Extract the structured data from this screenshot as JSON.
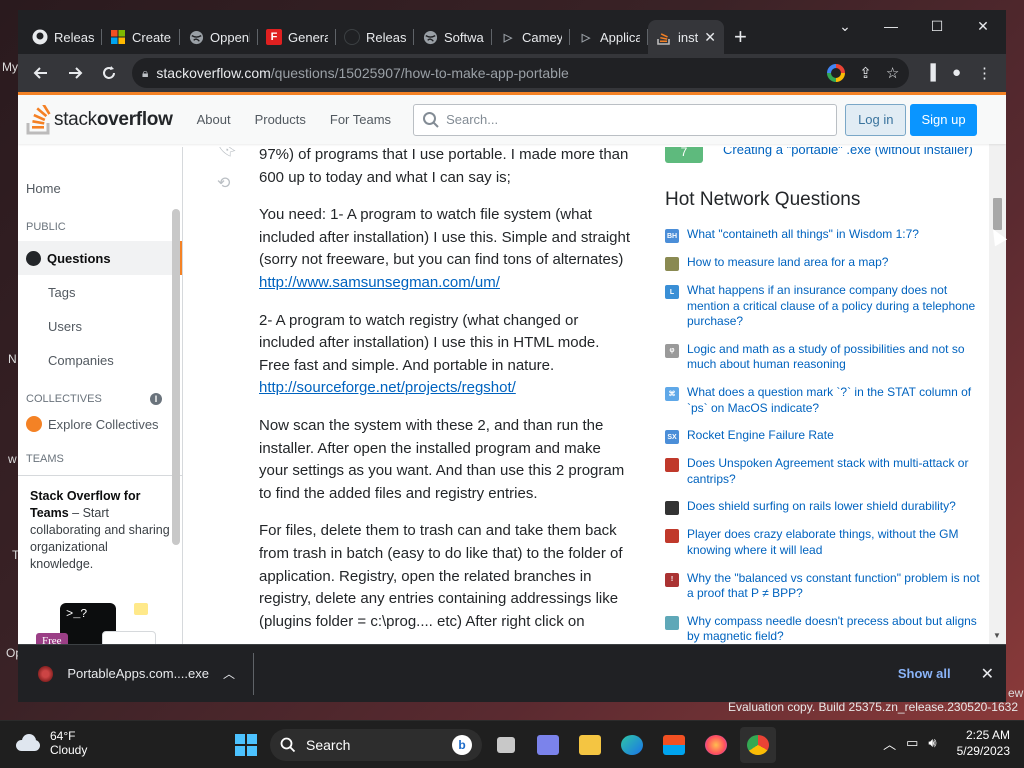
{
  "desktop": {
    "left_fragments": [
      "My",
      "N",
      "w",
      "T",
      "Op"
    ],
    "right_fragments": [
      "ew"
    ],
    "evaluation": "Evaluation copy. Build 25375.zn_release.230520-1632"
  },
  "browser": {
    "tabs": [
      {
        "label": "Release",
        "icon": "github-icon"
      },
      {
        "label": "Create",
        "icon": "microsoft-icon"
      },
      {
        "label": "Oppenl",
        "icon": "globe-icon"
      },
      {
        "label": "Genera",
        "icon": "f-logo-icon"
      },
      {
        "label": "Release",
        "icon": "github-icon"
      },
      {
        "label": "Softwa",
        "icon": "globe-icon"
      },
      {
        "label": "Cameyo",
        "icon": "play-icon"
      },
      {
        "label": "Applica",
        "icon": "play-icon"
      },
      {
        "label": "inst",
        "icon": "stackoverflow-icon"
      }
    ],
    "new_tab": "+",
    "window_controls": {
      "minimize": "—",
      "maximize": "☐",
      "close": "✕",
      "tablist": "⌄"
    },
    "url_host": "stackoverflow.com",
    "url_path": "/questions/15025907/how-to-make-app-portable"
  },
  "so": {
    "logo_prefix": "stack",
    "logo_bold": "overflow",
    "nav": [
      "About",
      "Products",
      "For Teams"
    ],
    "search_placeholder": "Search...",
    "login": "Log in",
    "signup": "Sign up",
    "sidebar": {
      "home": "Home",
      "public": "PUBLIC",
      "questions": "Questions",
      "tags": "Tags",
      "users": "Users",
      "companies": "Companies",
      "collectives": "COLLECTIVES",
      "explore_collectives": "Explore Collectives",
      "teams": "TEAMS",
      "teams_title": "Stack Overflow for Teams",
      "teams_desc": " – Start collaborating and sharing organizational knowledge.",
      "free_badge": "Free",
      "terminal_text": ">_?"
    },
    "answer": {
      "p0": "97%) of programs that I use portable. I made more than 600 up to today and what I can say is;",
      "p1_text": "You need: 1- A program to watch file system (what included after installation) I use this. Simple and straight (sorry not freeware, but you can find tons of alternates) ",
      "p1_link": "http://www.samsunsegman.com/um/",
      "p2_text": "2- A program to watch registry (what changed or included after installation) I use this in HTML mode. Free fast and simple. And portable in nature. ",
      "p2_link": "http://sourceforge.net/projects/regshot/",
      "p3": "Now scan the system with these 2, and than run the installer. After open the installed program and make your settings as you want. And than use this 2 program to find the added files and registry entries.",
      "p4": "For files, delete them to trash can and take them back from trash in batch (easy to do like that) to the folder of application. Registry, open the related branches in registry, delete any entries containing addressings like (plugins folder = c:\\prog.... etc) After right click on"
    },
    "related": {
      "score": "7",
      "title": "Creating a \"portable\" .exe (without installer)"
    },
    "hnq_title": "Hot Network Questions",
    "hnq": [
      {
        "icon": "hermeneutics-icon",
        "color": "#4b8ed8",
        "label": "BH",
        "text": "What \"containeth all things\" in Wisdom 1:7?"
      },
      {
        "icon": "gis-icon",
        "color": "#8a8a52",
        "label": "",
        "text": "How to measure land area for a map?"
      },
      {
        "icon": "law-icon",
        "color": "#3a8fd6",
        "label": "L",
        "text": "What happens if an insurance company does not mention a critical clause of a policy during a telephone purchase?"
      },
      {
        "icon": "philosophy-icon",
        "color": "#9a9a9a",
        "label": "φ",
        "text": "Logic and math as a study of possibilities and not so much about human reasoning"
      },
      {
        "icon": "unix-icon",
        "color": "#5fa8e8",
        "label": "⌘",
        "text": "What does a question mark `?` in the STAT column of `ps` on MacOS indicate?"
      },
      {
        "icon": "space-icon",
        "color": "#4b8ed8",
        "label": "SX",
        "text": "Rocket Engine Failure Rate"
      },
      {
        "icon": "rpg-icon",
        "color": "#c0392b",
        "label": "",
        "text": "Does Unspoken Agreement stack with multi-attack or cantrips?"
      },
      {
        "icon": "boardgames-icon",
        "color": "#333333",
        "label": "",
        "text": "Does shield surfing on rails lower shield durability?"
      },
      {
        "icon": "rpg-icon",
        "color": "#c0392b",
        "label": "",
        "text": "Player does crazy elaborate things, without the GM knowing where it will lead"
      },
      {
        "icon": "cstheory-icon",
        "color": "#a33",
        "label": "!",
        "text": "Why the \"balanced vs constant function\" problem is not a proof that P ≠ BPP?"
      },
      {
        "icon": "physics-icon",
        "color": "#5fa8b8",
        "label": "",
        "text": "Why compass needle doesn't precess about but aligns by magnetic field?"
      }
    ]
  },
  "downloads": {
    "file": "PortableApps.com....exe",
    "show_all": "Show all"
  },
  "taskbar": {
    "temp": "64°F",
    "condition": "Cloudy",
    "search": "Search",
    "time": "2:25 AM",
    "date": "5/29/2023"
  }
}
